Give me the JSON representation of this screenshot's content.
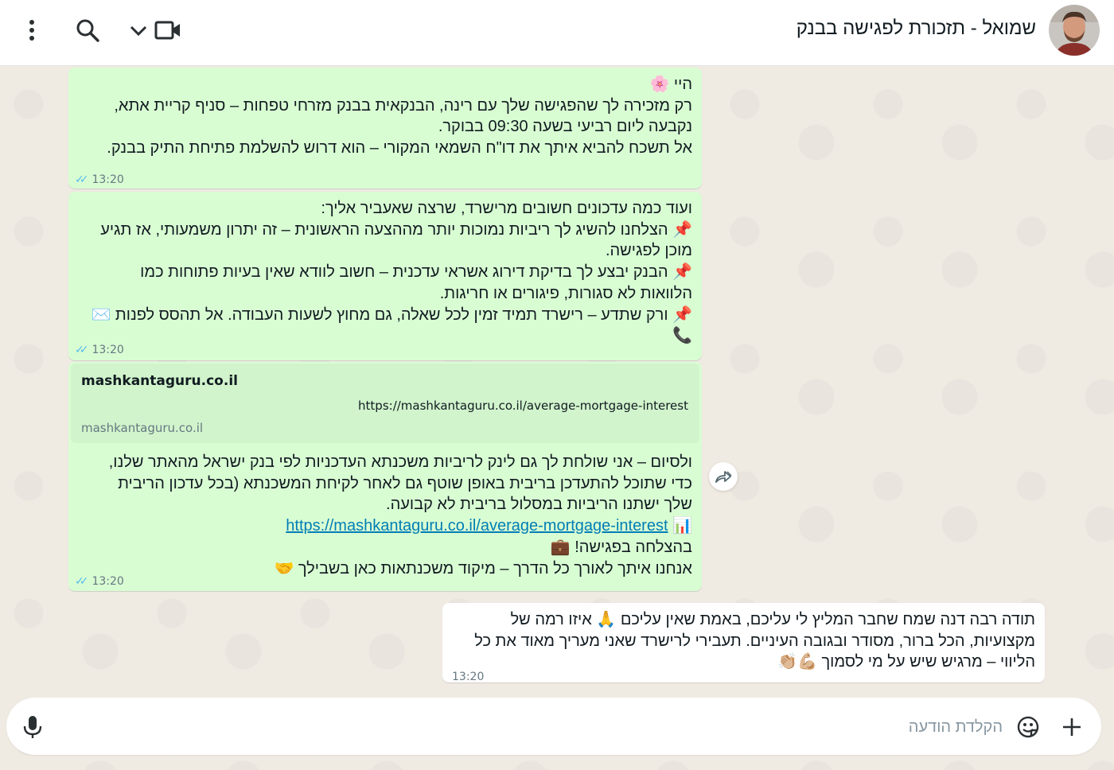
{
  "header": {
    "title": "שמואל - תזכורת לפגישה בבנק",
    "icons": [
      "video-icon",
      "chevron-down-icon",
      "search-icon",
      "more-vertical-icon"
    ]
  },
  "messages": [
    {
      "direction": "outgoing",
      "lines": [
        "היי 🌸",
        "רק מזכירה לך שהפגישה שלך עם רינה, הבנקאית בבנק מזרחי טפחות – סניף קריית אתא,",
        "נקבעה ליום רביעי בשעה 09:30 בבוקר.",
        "אל תשכח להביא איתך את דו\"ח השמאי המקורי – הוא דרוש להשלמת פתיחת התיק בבנק."
      ],
      "time": "13:20"
    },
    {
      "direction": "outgoing",
      "lines": [
        "ועוד כמה עדכונים חשובים מרישרד, שרצה שאעביר אליך:",
        "📌 הצלחנו להשיג לך ריביות נמוכות יותר מההצעה הראשונית – זה יתרון משמעותי, אז תגיע",
        "מוכן לפגישה.",
        "📌 הבנק יבצע לך בדיקת דירוג אשראי עדכנית – חשוב לוודא שאין בעיות פתוחות כמו",
        "הלוואות לא סגורות, פיגורים או חריגות.",
        "📌 ורק שתדע – רישרד תמיד זמין לכל שאלה, גם מחוץ לשעות העבודה. אל תהסס לפנות ✉️",
        "📞"
      ],
      "time": "13:20"
    },
    {
      "direction": "outgoing",
      "link_preview": {
        "title": "mashkantaguru.co.il",
        "url": "https://mashkantaguru.co.il/average-mortgage-interest",
        "domain": "mashkantaguru.co.il"
      },
      "lines": [
        "ולסיום – אני שולחת לך גם לינק לריביות משכנתא העדכניות לפי בנק ישראל מהאתר שלנו,",
        "כדי שתוכל להתעדכן בריבית באופן שוטף גם לאחר לקיחת המשכנתא (בכל עדכון הריבית",
        "שלך ישתנו הריביות במסלול בריבית לא קבועה.",
        "📊",
        "בהצלחה בפגישה! 💼",
        "אנחנו איתך לאורך כל הדרך – מיקוד משכנתאות כאן בשבילך 🤝"
      ],
      "link_text": "https://mashkantaguru.co.il/average-mortgage-interest",
      "time": "13:20"
    },
    {
      "direction": "incoming",
      "lines": [
        "תודה רבה דנה שמח שחבר המליץ לי עליכם, באמת שאין עליכם 🙏",
        "איזו רמה של מקצועיות, הכל ברור, מסודר ובגובה העיניים.",
        "תעבירי לרישרד שאני מעריך מאוד את כל הליווי – מרגיש שיש על מי לסמוך 💪🏼👏🏼"
      ],
      "time": "13:20"
    }
  ],
  "composer": {
    "placeholder": "הקלדת הודעה",
    "icons": [
      "plus-icon",
      "sticker-icon",
      "microphone-icon"
    ]
  },
  "colors": {
    "outgoing_bubble": "#d9fdd3",
    "incoming_bubble": "#ffffff",
    "chat_background": "#efeae2",
    "read_ticks": "#53bdeb",
    "link": "#027eb5"
  }
}
